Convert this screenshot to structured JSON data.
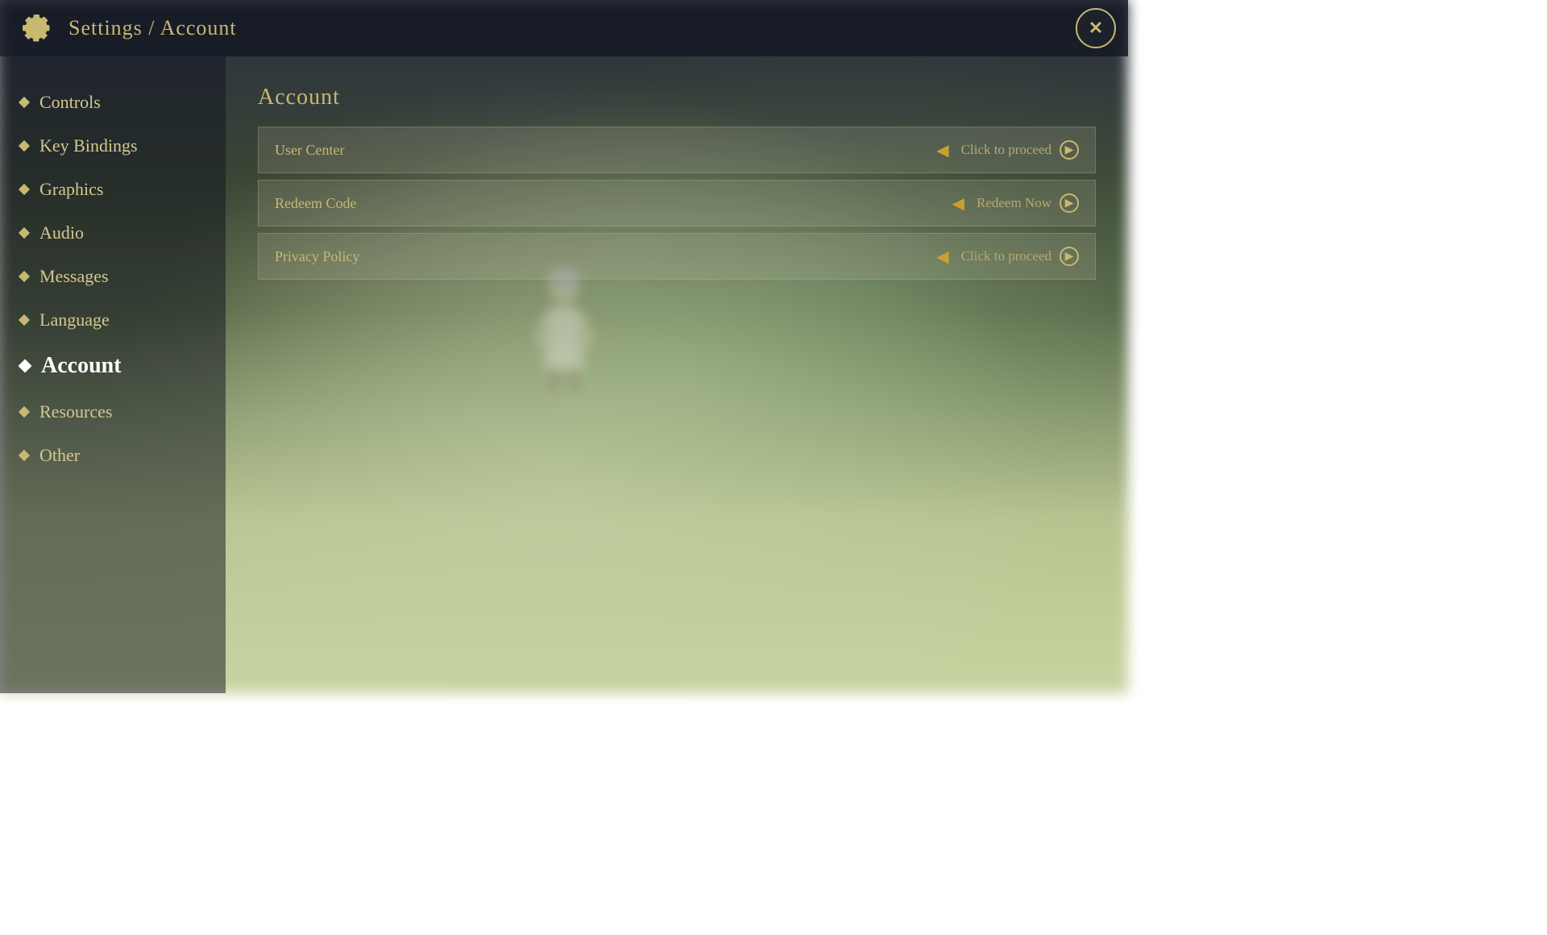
{
  "header": {
    "title": "Settings / Account",
    "close_label": "✕"
  },
  "sidebar": {
    "items": [
      {
        "id": "controls",
        "label": "Controls",
        "active": false
      },
      {
        "id": "key-bindings",
        "label": "Key Bindings",
        "active": false
      },
      {
        "id": "graphics",
        "label": "Graphics",
        "active": false
      },
      {
        "id": "audio",
        "label": "Audio",
        "active": false
      },
      {
        "id": "messages",
        "label": "Messages",
        "active": false
      },
      {
        "id": "language",
        "label": "Language",
        "active": false
      },
      {
        "id": "account",
        "label": "Account",
        "active": true
      },
      {
        "id": "resources",
        "label": "Resources",
        "active": false
      },
      {
        "id": "other",
        "label": "Other",
        "active": false
      }
    ]
  },
  "main": {
    "section_title": "Account",
    "rows": [
      {
        "id": "user-center",
        "label": "User Center",
        "action": "Click to proceed"
      },
      {
        "id": "redeem-code",
        "label": "Redeem Code",
        "action": "Redeem Now"
      },
      {
        "id": "privacy-policy",
        "label": "Privacy Policy",
        "action": "Click to proceed"
      }
    ]
  },
  "icons": {
    "gear": "⚙",
    "diamond": "◆",
    "arrow_right": "▶",
    "close": "✕",
    "arrow_icon": "◀"
  }
}
